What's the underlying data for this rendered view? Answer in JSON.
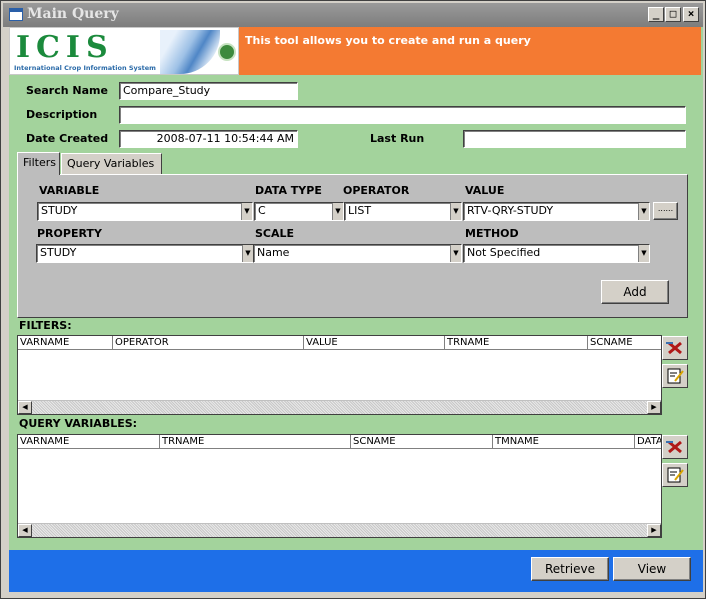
{
  "window": {
    "title": "Main Query",
    "minimize": "_",
    "maximize": "□",
    "close": "×"
  },
  "banner": {
    "logo_text": "ICIS",
    "logo_subtitle": "International Crop Information System",
    "message": "This tool allows you to create and run a query"
  },
  "fields": {
    "search_name_label": "Search Name",
    "search_name_value": "Compare_Study",
    "description_label": "Description",
    "description_value": "",
    "date_created_label": "Date Created",
    "date_created_value": "2008-07-11 10:54:44 AM",
    "last_run_label": "Last Run",
    "last_run_value": ""
  },
  "tabs": [
    {
      "label": "Filters",
      "active": true
    },
    {
      "label": "Query Variables",
      "active": false
    }
  ],
  "filters_panel": {
    "variable_label": "VARIABLE",
    "variable_value": "STUDY",
    "data_type_label": "DATA TYPE",
    "data_type_value": "C",
    "operator_label": "OPERATOR",
    "operator_value": "LIST",
    "value_label": "VALUE",
    "value_value": "RTV-QRY-STUDY",
    "ellipsis_label": "......",
    "property_label": "PROPERTY",
    "property_value": "STUDY",
    "scale_label": "SCALE",
    "scale_value": "Name",
    "method_label": "METHOD",
    "method_value": "Not Specified",
    "add_label": "Add"
  },
  "filters_grid": {
    "title": "FILTERS:",
    "columns": [
      "VARNAME",
      "OPERATOR",
      "VALUE",
      "TRNAME",
      "SCNAME"
    ]
  },
  "query_vars_grid": {
    "title": "QUERY VARIABLES:",
    "columns": [
      "VARNAME",
      "TRNAME",
      "SCNAME",
      "TMNAME",
      "DATA"
    ]
  },
  "footer": {
    "retrieve_label": "Retrieve",
    "view_label": "View"
  },
  "icons": {
    "app": "form-icon",
    "delete": "delete-x-icon",
    "edit": "edit-icon"
  },
  "colors": {
    "form_bg": "#a3d39c",
    "banner": "#f47a32",
    "footer": "#1e6fe8",
    "panel": "#bdbdbd"
  }
}
